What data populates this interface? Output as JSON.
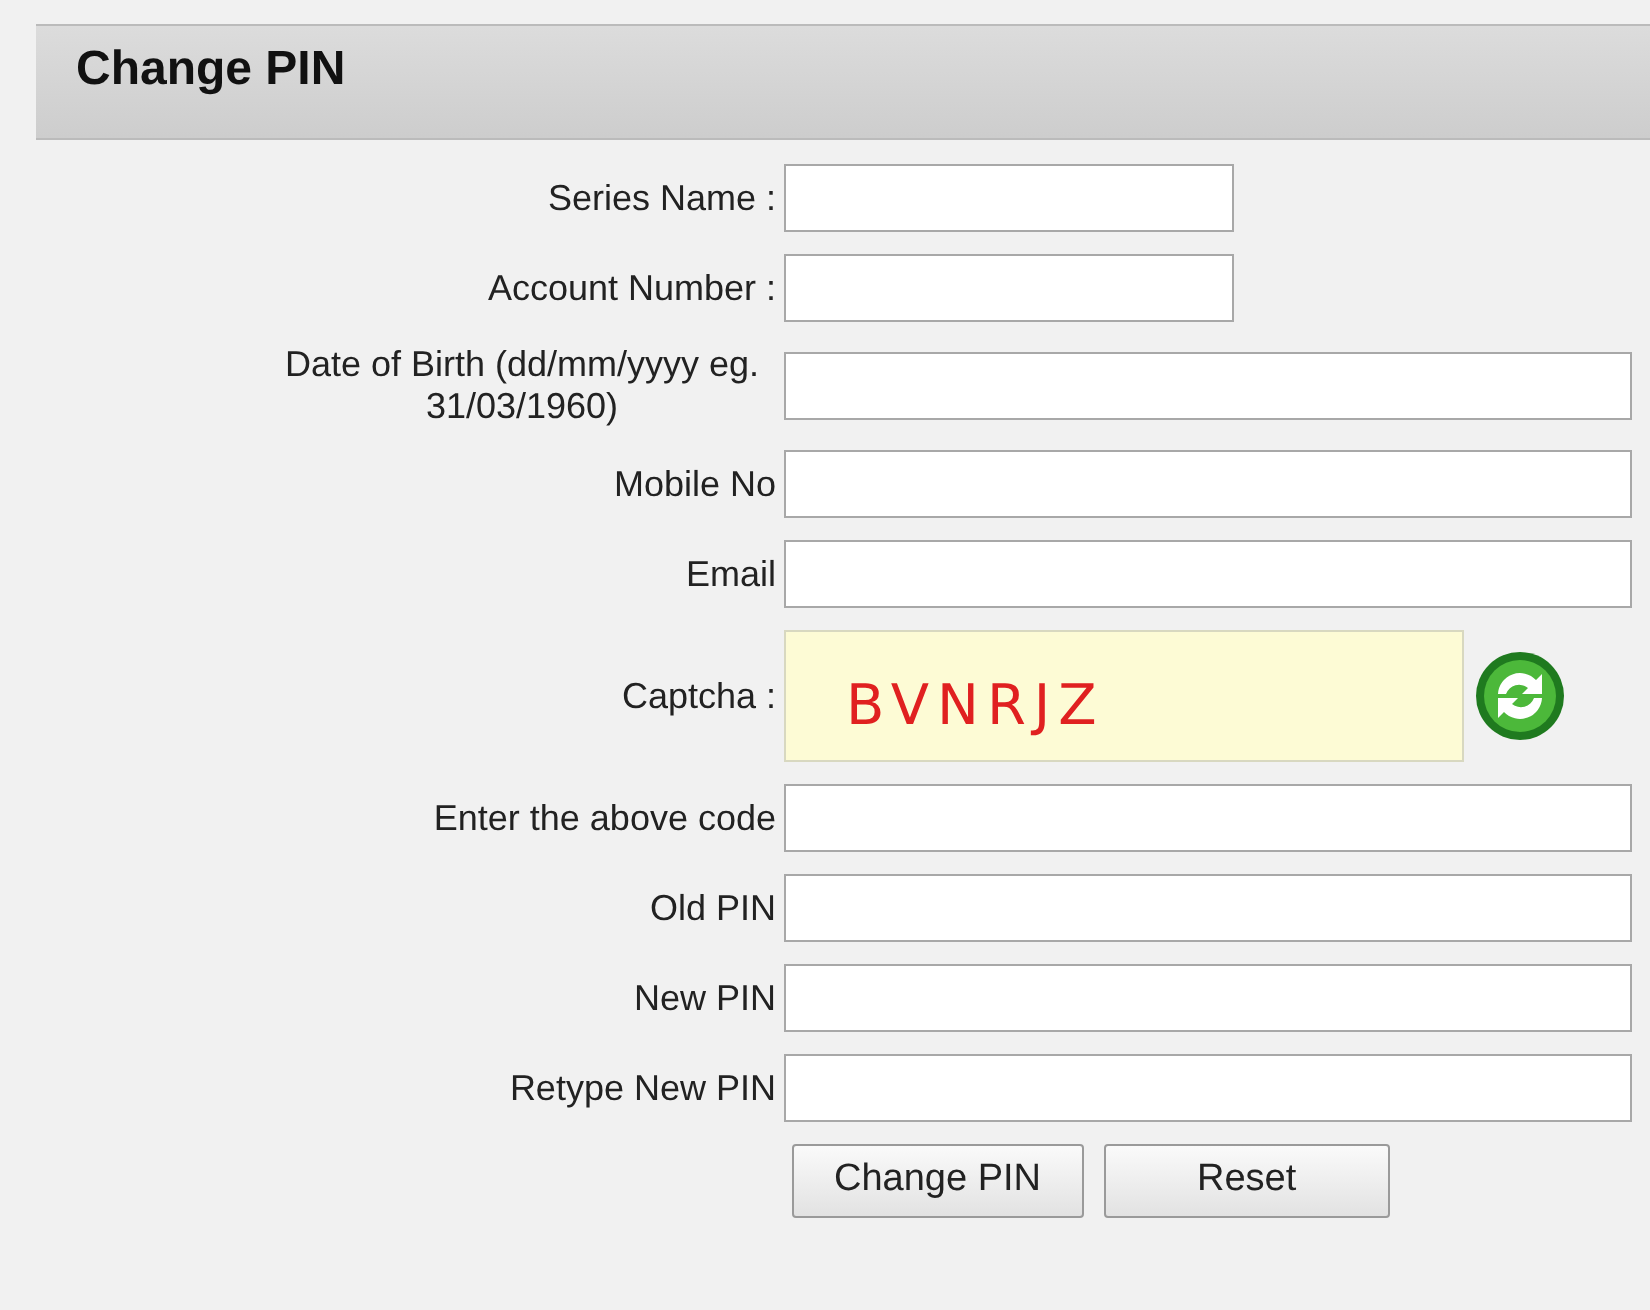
{
  "header": {
    "title": "Change PIN"
  },
  "fields": [
    {
      "label": "Series Name :",
      "kind": "short"
    },
    {
      "label": "Account Number :",
      "kind": "short"
    },
    {
      "label": "Date of Birth (dd/mm/yyyy eg. 31/03/1960)",
      "kind": "wide"
    },
    {
      "label": "Mobile No",
      "kind": "wide"
    },
    {
      "label": "Email",
      "kind": "wide"
    },
    {
      "label": "Captcha :",
      "kind": "captcha",
      "code": "BVNRJZ"
    },
    {
      "label": "Enter the above code",
      "kind": "wide"
    },
    {
      "label": "Old PIN",
      "kind": "wide"
    },
    {
      "label": "New PIN",
      "kind": "wide"
    },
    {
      "label": "Retype New PIN",
      "kind": "wide"
    }
  ],
  "buttons": [
    "Change PIN",
    "Reset"
  ]
}
